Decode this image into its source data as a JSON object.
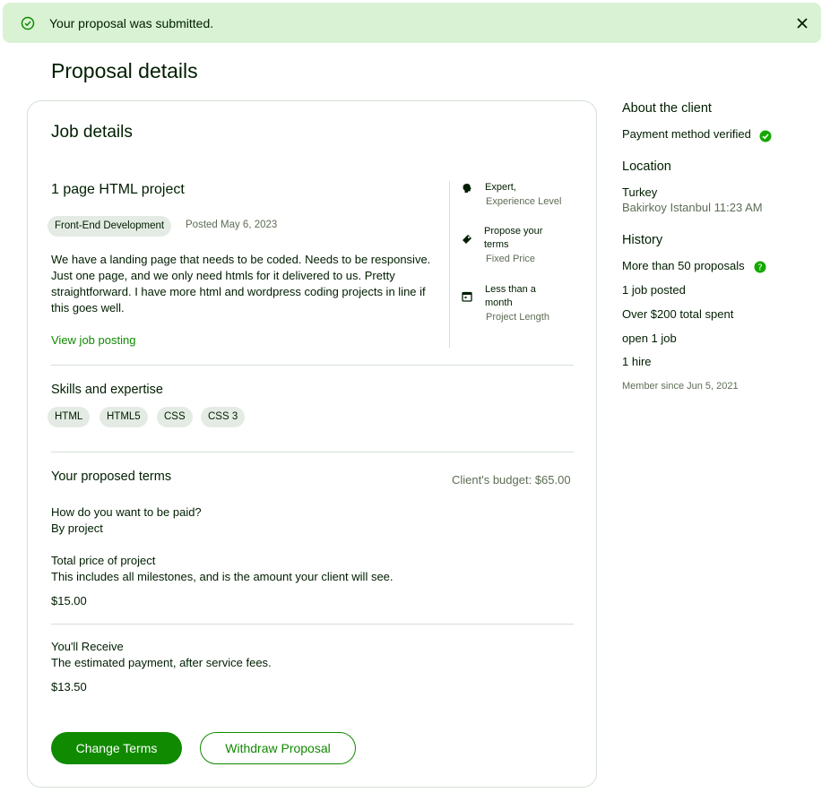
{
  "banner": {
    "message": "Your proposal was submitted."
  },
  "page_title": "Proposal details",
  "job": {
    "card_title": "Job details",
    "title": "1 page HTML project",
    "category": "Front-End Development",
    "posted": "Posted May 6, 2023",
    "description": "We have a landing page that needs to be coded. Needs to be responsive. Just one page, and we only need htmls for it delivered to us. Pretty straightforward. I have more html and wordpress coding projects in line if this goes well.",
    "view_link": "View job posting",
    "attributes": [
      {
        "icon": "brain-icon",
        "label": "Expert,",
        "sub": "Experience Level"
      },
      {
        "icon": "tag-icon",
        "label": "Propose your terms",
        "sub": "Fixed Price"
      },
      {
        "icon": "calendar-icon",
        "label": "Less than a month",
        "sub": "Project Length"
      }
    ]
  },
  "skills": {
    "title": "Skills and expertise",
    "items": [
      "HTML",
      "HTML5",
      "CSS",
      "CSS 3"
    ]
  },
  "terms": {
    "title": "Your proposed terms",
    "budget": "Client's budget: $65.00",
    "paid_q": "How do you want to be paid?",
    "paid_a": "By project",
    "total_label": "Total price of project",
    "total_desc": "This includes all milestones, and is the amount your client will see.",
    "total_value": "$15.00",
    "receive_label": "You'll Receive",
    "receive_desc": "The estimated payment, after service fees.",
    "receive_value": "$13.50"
  },
  "buttons": {
    "change": "Change Terms",
    "withdraw": "Withdraw Proposal"
  },
  "client": {
    "about_title": "About the client",
    "payment": "Payment method verified",
    "location_title": "Location",
    "country": "Turkey",
    "city_time": "Bakirkoy Istanbul 11:23 AM",
    "history_title": "History",
    "proposals": "More than 50 proposals",
    "jobs_posted": "1 job posted",
    "spent": "Over $200 total spent",
    "open_jobs": "open 1 job",
    "hires": "1 hire",
    "member_since": "Member since Jun 5, 2021"
  },
  "colors": {
    "accent": "#108a00",
    "banner_bg": "#d9f2d4",
    "pill_bg": "#e4ebe4"
  }
}
